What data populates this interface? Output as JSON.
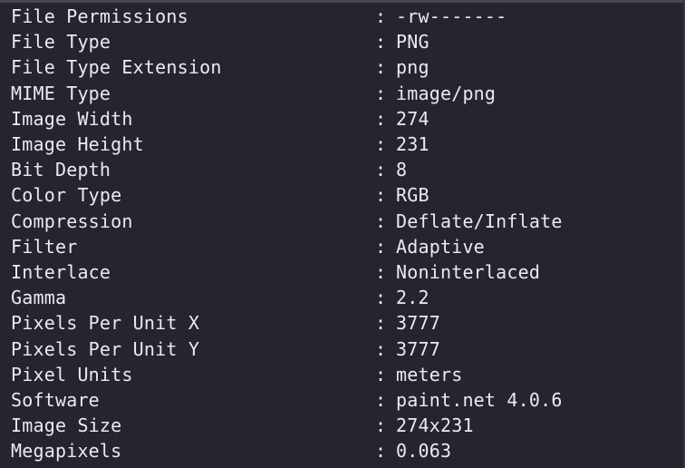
{
  "terminal": {
    "separator": ":",
    "rows": [
      {
        "key": "File Permissions",
        "value": "-rw-------"
      },
      {
        "key": "File Type",
        "value": "PNG"
      },
      {
        "key": "File Type Extension",
        "value": "png"
      },
      {
        "key": "MIME Type",
        "value": "image/png"
      },
      {
        "key": "Image Width",
        "value": "274"
      },
      {
        "key": "Image Height",
        "value": "231"
      },
      {
        "key": "Bit Depth",
        "value": "8"
      },
      {
        "key": "Color Type",
        "value": "RGB"
      },
      {
        "key": "Compression",
        "value": "Deflate/Inflate"
      },
      {
        "key": "Filter",
        "value": "Adaptive"
      },
      {
        "key": "Interlace",
        "value": "Noninterlaced"
      },
      {
        "key": "Gamma",
        "value": "2.2"
      },
      {
        "key": "Pixels Per Unit X",
        "value": "3777"
      },
      {
        "key": "Pixels Per Unit Y",
        "value": "3777"
      },
      {
        "key": "Pixel Units",
        "value": "meters"
      },
      {
        "key": "Software",
        "value": "paint.net 4.0.6"
      },
      {
        "key": "Image Size",
        "value": "274x231"
      },
      {
        "key": "Megapixels",
        "value": "0.063"
      }
    ]
  },
  "colors": {
    "background": "#27232f",
    "text": "#ece8f4"
  }
}
